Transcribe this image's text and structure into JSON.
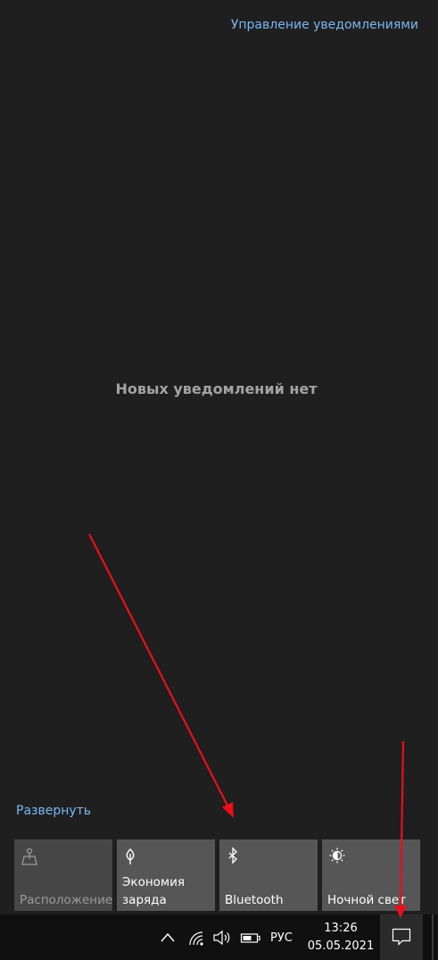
{
  "header": {
    "manage_notifications": "Управление уведомлениями"
  },
  "main": {
    "empty_message": "Новых уведомлений нет"
  },
  "footer": {
    "expand_label": "Развернуть"
  },
  "quick_actions": [
    {
      "label": "Расположение",
      "icon": "location-icon",
      "state": "disabled"
    },
    {
      "label": "Экономия\nзаряда",
      "icon": "battery-saver-icon",
      "state": "off"
    },
    {
      "label": "Bluetooth",
      "icon": "bluetooth-icon",
      "state": "off"
    },
    {
      "label": "Ночной свет",
      "icon": "night-light-icon",
      "state": "off"
    }
  ],
  "taskbar": {
    "language": "РУС",
    "time": "13:26",
    "date": "05.05.2021"
  },
  "colors": {
    "link": "#7ab7f0",
    "annotation_arrow": "#e8101b"
  }
}
